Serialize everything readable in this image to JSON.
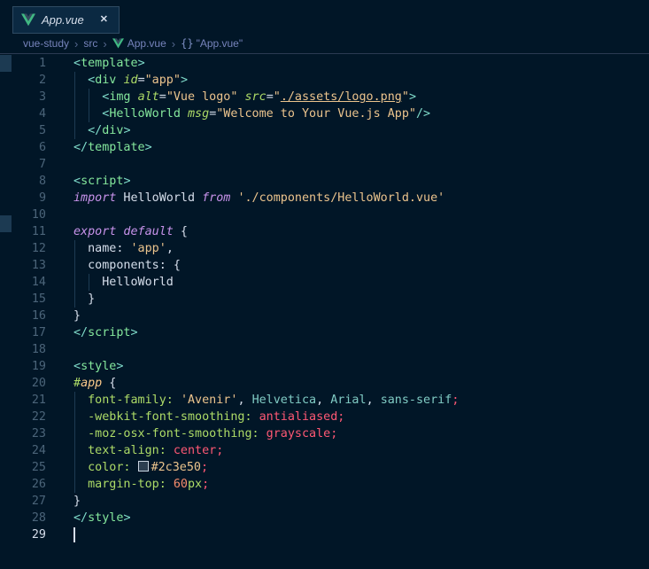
{
  "tab_bar": {
    "tabs": [
      {
        "label": "App.vue",
        "icon": "vue-logo",
        "close_glyph": "✕",
        "active": true
      }
    ]
  },
  "breadcrumb": {
    "separator": "›",
    "items": [
      {
        "label": "vue-study"
      },
      {
        "label": "src"
      },
      {
        "label": "App.vue",
        "icon": "vue-logo"
      },
      {
        "label": "\"App.vue\"",
        "icon": "symbol-braces",
        "icon_glyph": "{}"
      }
    ]
  },
  "editor": {
    "active_line": 29,
    "cursor": {
      "line": 29,
      "col": 0
    },
    "gutter_marks": [
      {
        "line": 1
      },
      {
        "line": 10.5
      }
    ],
    "lines": [
      [
        [
          "pt",
          "<"
        ],
        [
          "tg",
          "template"
        ],
        [
          "pt",
          ">"
        ]
      ],
      [
        [
          "tx",
          "  "
        ],
        [
          "pt",
          "<"
        ],
        [
          "tg",
          "div"
        ],
        [
          "tx",
          " "
        ],
        [
          "at",
          "id"
        ],
        [
          "tx",
          "="
        ],
        [
          "st",
          "\"app\""
        ],
        [
          "pt",
          ">"
        ]
      ],
      [
        [
          "tx",
          "    "
        ],
        [
          "pt",
          "<"
        ],
        [
          "tg",
          "img"
        ],
        [
          "tx",
          " "
        ],
        [
          "at",
          "alt"
        ],
        [
          "tx",
          "="
        ],
        [
          "st",
          "\"Vue logo\""
        ],
        [
          "tx",
          " "
        ],
        [
          "at",
          "src"
        ],
        [
          "tx",
          "="
        ],
        [
          "st",
          "\""
        ],
        [
          "lk",
          "./assets/logo.png"
        ],
        [
          "st",
          "\""
        ],
        [
          "pt",
          ">"
        ]
      ],
      [
        [
          "tx",
          "    "
        ],
        [
          "pt",
          "<"
        ],
        [
          "tg",
          "HelloWorld"
        ],
        [
          "tx",
          " "
        ],
        [
          "at",
          "msg"
        ],
        [
          "tx",
          "="
        ],
        [
          "st",
          "\"Welcome to Your Vue.js App\""
        ],
        [
          "pt",
          "/>"
        ]
      ],
      [
        [
          "tx",
          "  "
        ],
        [
          "pt",
          "</"
        ],
        [
          "tg",
          "div"
        ],
        [
          "pt",
          ">"
        ]
      ],
      [
        [
          "pt",
          "</"
        ],
        [
          "tg",
          "template"
        ],
        [
          "pt",
          ">"
        ]
      ],
      [],
      [
        [
          "pt",
          "<"
        ],
        [
          "tg",
          "script"
        ],
        [
          "pt",
          ">"
        ]
      ],
      [
        [
          "kw",
          "import"
        ],
        [
          "tx",
          " HelloWorld "
        ],
        [
          "kw",
          "from"
        ],
        [
          "tx",
          " "
        ],
        [
          "st",
          "'./components/HelloWorld.vue'"
        ]
      ],
      [],
      [
        [
          "kw",
          "export default"
        ],
        [
          "tx",
          " {"
        ]
      ],
      [
        [
          "tx",
          "  name: "
        ],
        [
          "st",
          "'app'"
        ],
        [
          "tx",
          ","
        ]
      ],
      [
        [
          "tx",
          "  components: {"
        ]
      ],
      [
        [
          "tx",
          "    HelloWorld"
        ]
      ],
      [
        [
          "tx",
          "  }"
        ]
      ],
      [
        [
          "tx",
          "}"
        ]
      ],
      [
        [
          "pt",
          "</"
        ],
        [
          "tg",
          "script"
        ],
        [
          "pt",
          ">"
        ]
      ],
      [],
      [
        [
          "pt",
          "<"
        ],
        [
          "tg",
          "style"
        ],
        [
          "pt",
          ">"
        ]
      ],
      [
        [
          "ih",
          "#"
        ],
        [
          "in",
          "app"
        ],
        [
          "tx",
          " {"
        ]
      ],
      [
        [
          "tx",
          "  "
        ],
        [
          "pr",
          "font-family:"
        ],
        [
          "tx",
          " "
        ],
        [
          "st",
          "'Avenir'"
        ],
        [
          "tx",
          ", "
        ],
        [
          "fv",
          "Helvetica"
        ],
        [
          "tx",
          ", "
        ],
        [
          "fv",
          "Arial"
        ],
        [
          "tx",
          ", "
        ],
        [
          "fv",
          "sans-serif"
        ],
        [
          "vl",
          ";"
        ]
      ],
      [
        [
          "tx",
          "  "
        ],
        [
          "pr",
          "-webkit-font-smoothing:"
        ],
        [
          "tx",
          " "
        ],
        [
          "vl",
          "antialiased;"
        ]
      ],
      [
        [
          "tx",
          "  "
        ],
        [
          "pr",
          "-moz-osx-font-smoothing:"
        ],
        [
          "tx",
          " "
        ],
        [
          "vl",
          "grayscale;"
        ]
      ],
      [
        [
          "tx",
          "  "
        ],
        [
          "pr",
          "text-align:"
        ],
        [
          "tx",
          " "
        ],
        [
          "vl",
          "center;"
        ]
      ],
      [
        [
          "tx",
          "  "
        ],
        [
          "pr",
          "color:"
        ],
        [
          "tx",
          " "
        ],
        [
          "sw",
          "#2c3e50"
        ],
        [
          "hx",
          "#2c3e50"
        ],
        [
          "vl",
          ";"
        ]
      ],
      [
        [
          "tx",
          "  "
        ],
        [
          "pr",
          "margin-top:"
        ],
        [
          "tx",
          " "
        ],
        [
          "nm",
          "60"
        ],
        [
          "un",
          "px"
        ],
        [
          "vl",
          ";"
        ]
      ],
      [
        [
          "tx",
          "}"
        ]
      ],
      [
        [
          "pt",
          "</"
        ],
        [
          "tg",
          "style"
        ],
        [
          "pt",
          ">"
        ]
      ],
      []
    ]
  },
  "palette": {
    "background": "#011627",
    "foreground": "#d6deeb",
    "line_number": "#4b6479",
    "active_line_number": "#d6deeb",
    "tab_active_background": "#0b2942",
    "tab_border": "#2e4a62",
    "header_border": "#2b3a52",
    "breadcrumb_foreground": "#7683bb",
    "indent_guide": "#1d3b53",
    "gutter_mark": "#1c3a52",
    "cursor": "#d6deeb",
    "token_tag_punctuation": "#7fdbca",
    "token_tag_name": "#85e89d",
    "token_attribute": "#addb67",
    "token_string": "#ecc48d",
    "token_keyword": "#c792ea",
    "token_css_property": "#addb67",
    "token_css_value_keyword": "#ff5874",
    "token_number": "#f78c6c",
    "token_font_name": "#80cbc4",
    "token_id_selector": "#ffcb8b",
    "token_hex_color": "#ecc48d",
    "swatch_fill": "#2c3e50",
    "vue_logo_green": "#41b883",
    "vue_logo_dark": "#34495e"
  }
}
